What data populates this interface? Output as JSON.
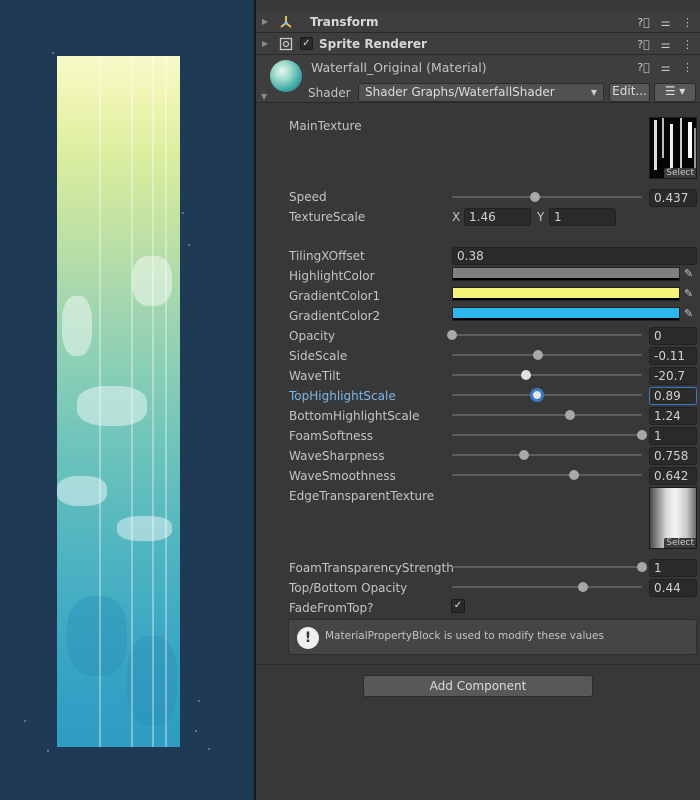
{
  "scene": {
    "background": "#1e3a54",
    "waterfall_gradient": [
      "#f7fac9",
      "#c3e3a2",
      "#6bc2bb",
      "#2f9cc3"
    ]
  },
  "components": {
    "transform": {
      "title": "Transform"
    },
    "sprite_renderer": {
      "title": "Sprite Renderer"
    }
  },
  "material": {
    "name": "Waterfall_Original (Material)",
    "shader_label": "Shader",
    "shader_value": "Shader Graphs/WaterfallShader",
    "edit_label": "Edit..."
  },
  "properties": {
    "main_texture": {
      "label": "MainTexture",
      "select": "Select"
    },
    "speed": {
      "label": "Speed",
      "value": "0.437",
      "slider": 0.437
    },
    "texture_scale": {
      "label": "TextureScale",
      "x_label": "X",
      "x": "1.46",
      "y_label": "Y",
      "y": "1"
    },
    "tiling_x_offset": {
      "label": "TilingXOffset",
      "value": "0.38"
    },
    "highlight_color": {
      "label": "HighlightColor",
      "color": "#808080"
    },
    "gradient_color1": {
      "label": "GradientColor1",
      "color": "#f5f57a"
    },
    "gradient_color2": {
      "label": "GradientColor2",
      "color": "#2bb6ee"
    },
    "opacity": {
      "label": "Opacity",
      "value": "0",
      "slider": 0.0
    },
    "side_scale": {
      "label": "SideScale",
      "value": "-0.11",
      "slider": 0.45
    },
    "wave_tilt": {
      "label": "WaveTilt",
      "value": "-20.7",
      "slider": 0.39
    },
    "top_highlight_scale": {
      "label": "TopHighlightScale",
      "value": "0.89",
      "slider": 0.445
    },
    "bottom_highlight_scale": {
      "label": "BottomHighlightScale",
      "value": "1.24",
      "slider": 0.62
    },
    "foam_softness": {
      "label": "FoamSoftness",
      "value": "1",
      "slider": 1.0
    },
    "wave_sharpness": {
      "label": "WaveSharpness",
      "value": "0.758",
      "slider": 0.379
    },
    "wave_smoothness": {
      "label": "WaveSmoothness",
      "value": "0.642",
      "slider": 0.642
    },
    "edge_transparent_texture": {
      "label": "EdgeTransparentTexture",
      "select": "Select"
    },
    "foam_transparency_strength": {
      "label": "FoamTransparencyStrength",
      "value": "1",
      "slider": 1.0
    },
    "top_bottom_opacity": {
      "label": "Top/Bottom Opacity",
      "value": "0.44",
      "slider": 0.69
    },
    "fade_from_top": {
      "label": "FadeFromTop?",
      "checked": true
    }
  },
  "help": {
    "text": "MaterialPropertyBlock is used to modify these values"
  },
  "add_component": {
    "label": "Add Component"
  }
}
